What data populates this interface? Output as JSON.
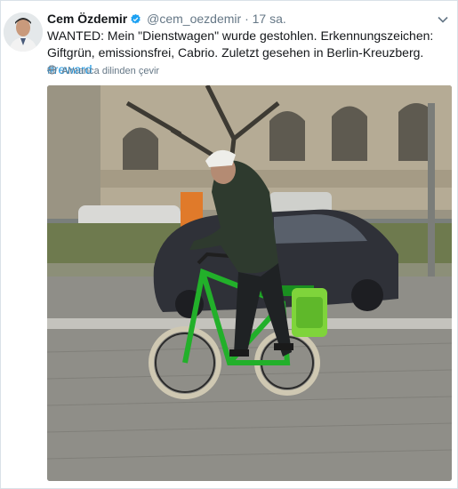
{
  "tweet": {
    "author_name": "Cem Özdemir",
    "handle": "@cem_oezdemir",
    "separator": "·",
    "time": "17 sa.",
    "text_main": "WANTED: Mein \"Dienstwagen\" wurde gestohlen. Erkennungszeichen: Giftgrün, emissionsfrei, Cabrio. Zuletzt gesehen in Berlin-Kreuzberg.",
    "hashtag": "#reward",
    "translate_label": "Almanca dilinden çevir"
  },
  "icons": {
    "verified": "verified-badge-icon",
    "caret": "chevron-down-icon",
    "translate": "globe-icon"
  },
  "colors": {
    "link": "#1b95e0",
    "verified": "#1da1f2",
    "secondary_text": "#657786",
    "bike_green": "#22b02a"
  }
}
